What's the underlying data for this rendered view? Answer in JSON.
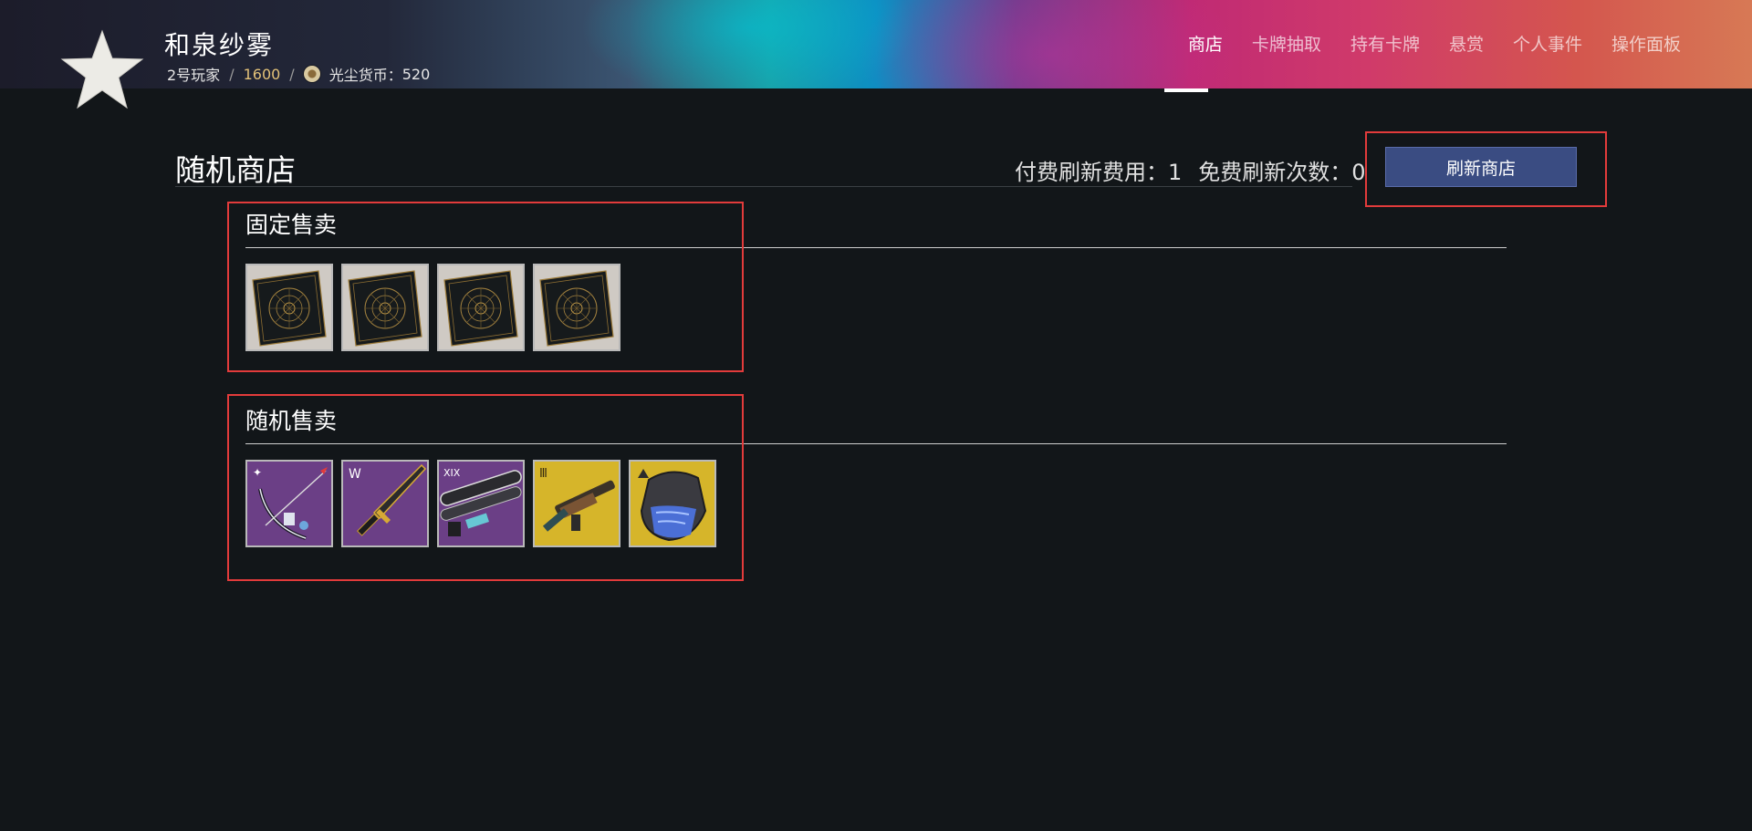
{
  "header": {
    "player_name": "和泉纱雾",
    "player_tag": "2号玩家",
    "separator": "/",
    "power_level": "1600",
    "currency_label": "光尘货币：",
    "currency_value": "520",
    "nav": [
      {
        "label": "商店",
        "active": true
      },
      {
        "label": "卡牌抽取",
        "active": false
      },
      {
        "label": "持有卡牌",
        "active": false
      },
      {
        "label": "悬赏",
        "active": false
      },
      {
        "label": "个人事件",
        "active": false
      },
      {
        "label": "操作面板",
        "active": false
      }
    ]
  },
  "shop": {
    "title": "随机商店",
    "paid_refresh_label": "付费刷新费用：",
    "paid_refresh_value": "1",
    "free_refresh_label": "免费刷新次数：",
    "free_refresh_value": "0",
    "refresh_button": "刷新商店"
  },
  "sections": {
    "fixed": {
      "title": "固定售卖",
      "items": [
        "card-pack-icon",
        "card-pack-icon",
        "card-pack-icon",
        "card-pack-icon"
      ]
    },
    "random": {
      "title": "随机售卖",
      "items": [
        "bow-weapon-icon",
        "sword-weapon-icon",
        "heavy-weapon-icon",
        "rifle-weapon-icon",
        "helmet-armor-icon"
      ]
    }
  },
  "colors": {
    "background": "#121619",
    "highlight_box": "#e23b3b",
    "refresh_button": "#3a4c82",
    "power_level": "#e2c178",
    "purple_item_bg": "#6b3f86",
    "gold_item_bg": "#d6b52a"
  }
}
